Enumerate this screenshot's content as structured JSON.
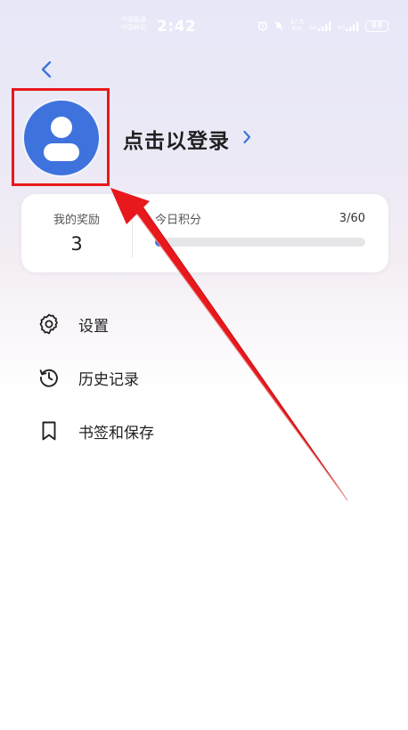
{
  "status_bar": {
    "carrier_1": "中国联通",
    "carrier_2": "中国移动",
    "time": "2:42",
    "net_speed_value": "47.5",
    "net_speed_unit": "K/s",
    "network_1": "5G",
    "network_2": "4G",
    "battery": "83"
  },
  "profile": {
    "login_text": "点击以登录"
  },
  "stats": {
    "rewards_label": "我的奖励",
    "rewards_value": "3",
    "points_label": "今日积分",
    "points_count": "3/60",
    "points_current": 3,
    "points_max": 60
  },
  "menu": {
    "items": [
      {
        "label": "设置",
        "icon": "gear-icon"
      },
      {
        "label": "历史记录",
        "icon": "history-icon"
      },
      {
        "label": "书签和保存",
        "icon": "bookmark-icon"
      }
    ]
  },
  "colors": {
    "accent": "#3e72dd",
    "highlight": "#e8191c"
  }
}
